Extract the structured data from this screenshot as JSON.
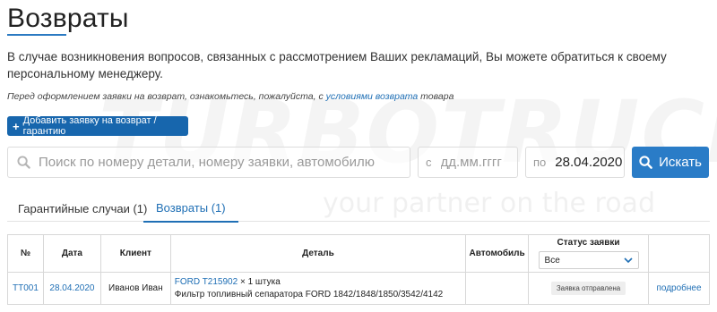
{
  "watermark": {
    "brand": "TURBOTRUCKS",
    "tagline": "your partner on the road"
  },
  "page": {
    "title": "Возвраты",
    "intro": "В случае возникновения вопросов, связанных с рассмотрением Ваших рекламаций, Вы можете обратиться к своему персональному менеджеру.",
    "note_prefix": "Перед оформлением заявки на возврат, ознакомьтесь, пожалуйста, с ",
    "note_link": "условиями возврата",
    "note_suffix": " товара"
  },
  "actions": {
    "add_button": "Добавить заявку на возврат / гарантию"
  },
  "search": {
    "placeholder": "Поиск по номеру детали, номеру заявки, автомобилю",
    "date_from_prefix": "с",
    "date_from_placeholder": "дд.мм.гггг",
    "date_to_prefix": "по",
    "date_to_value": "28.04.2020",
    "button_label": "Искать"
  },
  "tabs": [
    {
      "label": "Гарантийные случаи (1)"
    },
    {
      "label": "Возвраты (1)"
    }
  ],
  "table": {
    "headers": {
      "number": "№",
      "date": "Дата",
      "client": "Клиент",
      "detail": "Деталь",
      "car": "Автомобиль",
      "status": "Статус заявки"
    },
    "status_filter": "Все",
    "rows": [
      {
        "number": "TT001",
        "date": "28.04.2020",
        "client": "Иванов Иван",
        "part_link": "FORD T215902",
        "quantity": " × 1 штука",
        "part_desc": "Фильтр топливный сепаратора FORD 1842/1848/1850/3542/4142",
        "car": "",
        "status": "Заявка отправлена",
        "more": "подробнее"
      }
    ]
  },
  "colors": {
    "accent": "#1766ad",
    "link": "#1f6fb5"
  }
}
